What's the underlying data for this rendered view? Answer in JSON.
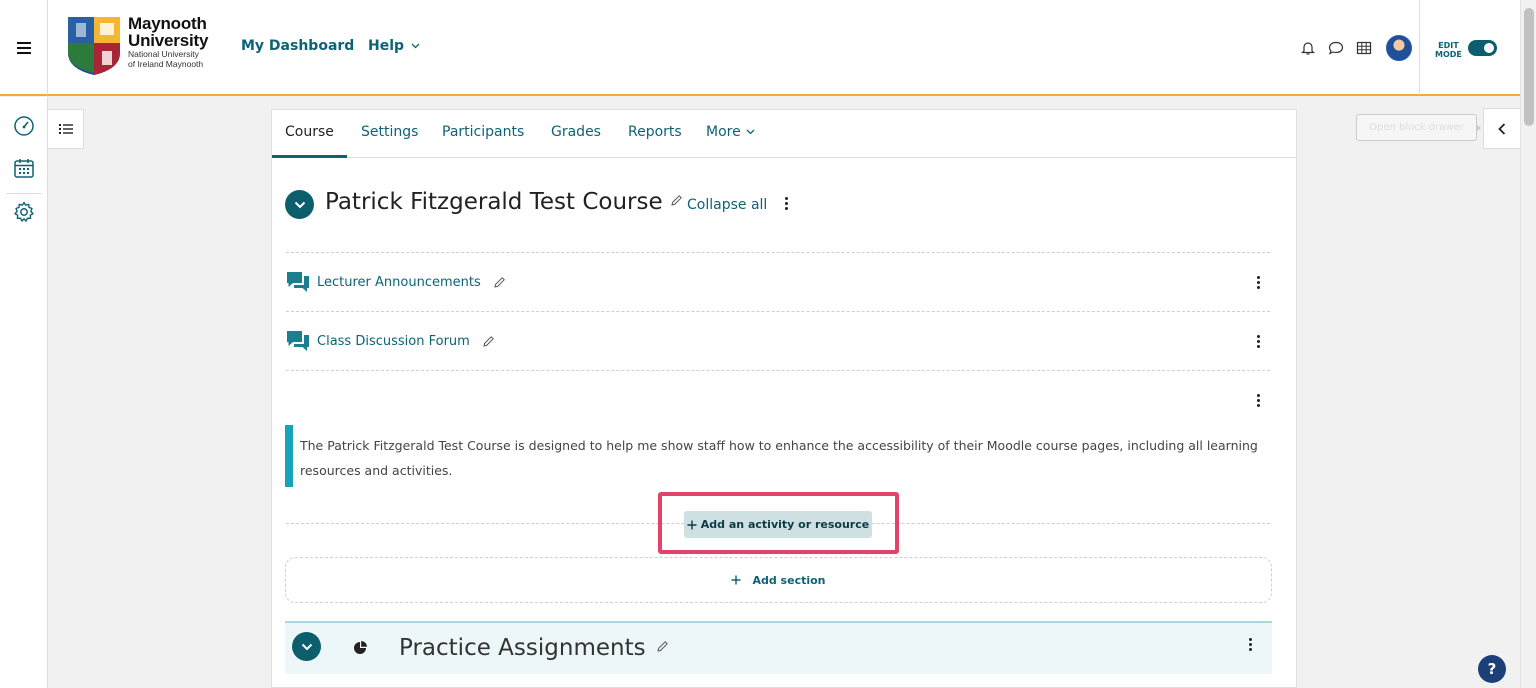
{
  "navbar": {
    "logo_name_line1": "Maynooth",
    "logo_name_line2": "University",
    "logo_sub_line1": "National University",
    "logo_sub_line2": "of Ireland Maynooth",
    "dashboard_label": "My Dashboard",
    "help_label": "Help",
    "edit_mode_line1": "EDIT",
    "edit_mode_line2": "MODE",
    "edit_mode_on": true
  },
  "drawer": {
    "tooltip": "Open block drawer"
  },
  "tabs": [
    "Course",
    "Settings",
    "Participants",
    "Grades",
    "Reports",
    "More"
  ],
  "course": {
    "title": "Patrick Fitzgerald Test Course",
    "collapse_all": "Collapse all",
    "activities": [
      {
        "name": "Lecturer Announcements",
        "icon": "forum-icon"
      },
      {
        "name": "Class Discussion Forum",
        "icon": "forum-icon"
      }
    ],
    "summary": "The Patrick Fitzgerald Test Course is designed to help me show staff how to enhance the accessibility of their Moodle course pages, including all learning resources and activities.",
    "add_activity_label": "Add an activity or resource",
    "add_section_label": "Add section"
  },
  "section2": {
    "title": "Practice Assignments"
  },
  "help_label": "?",
  "colors": {
    "brand_teal": "#0d6376",
    "accent_orange": "#f0a93b",
    "highlight_pink": "#e04569",
    "summary_bar": "#17a3b8"
  }
}
